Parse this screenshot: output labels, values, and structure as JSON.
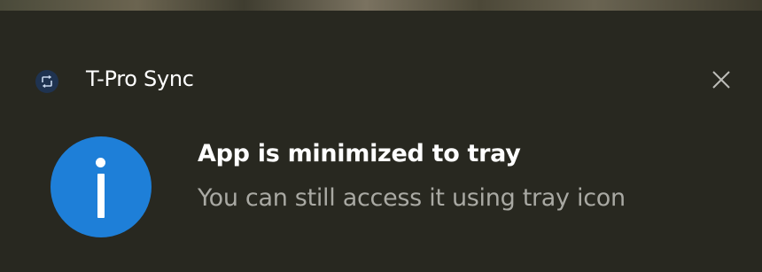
{
  "notification": {
    "app_name": "T-Pro Sync",
    "title": "App is minimized to tray",
    "message": "You can still access it using tray icon",
    "close_icon": "close-icon",
    "app_icon": "sync-app-icon",
    "info_icon": "info-icon"
  },
  "colors": {
    "background": "#282820",
    "title_text": "#ffffff",
    "message_text": "#a9a9a3",
    "info_accent": "#1e7fd8",
    "app_icon_bg": "#1f3350"
  }
}
